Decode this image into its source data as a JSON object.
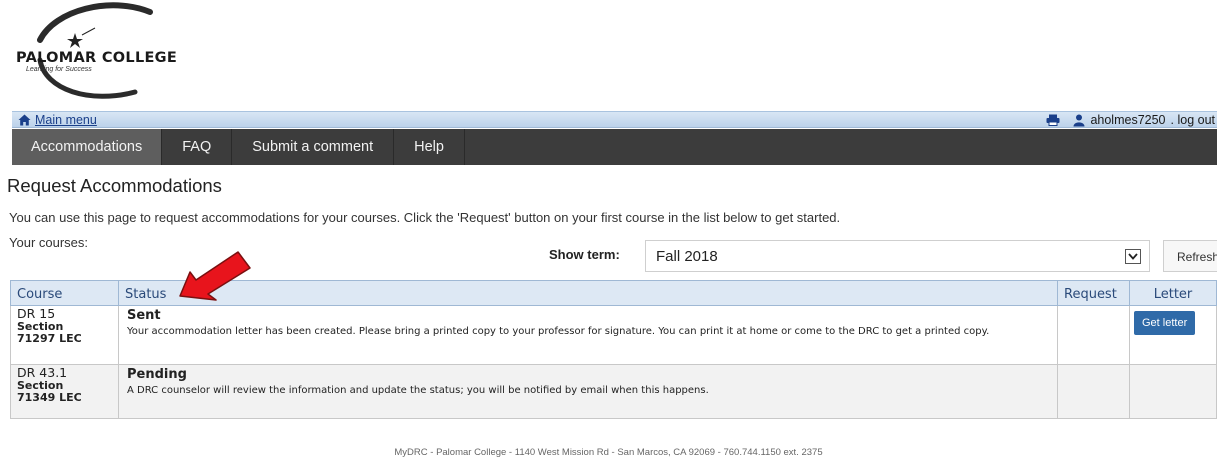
{
  "logo": {
    "name": "PALOMAR COLLEGE",
    "tagline": "Learning for Success"
  },
  "topbar": {
    "home_label": "Main menu",
    "user": "aholmes7250",
    "logout": ". log out"
  },
  "nav": {
    "tabs": [
      {
        "label": "Accommodations",
        "active": true
      },
      {
        "label": "FAQ",
        "active": false
      },
      {
        "label": "Submit a comment",
        "active": false
      },
      {
        "label": "Help",
        "active": false
      }
    ]
  },
  "page": {
    "title": "Request Accommodations",
    "intro": "You can use this page to request accommodations for your courses. Click the 'Request' button on your first course in the list below to get started.",
    "courses_label": "Your courses:",
    "term_label": "Show term:",
    "term_value": "Fall 2018",
    "refresh_label": "Refresh"
  },
  "table": {
    "headers": {
      "course": "Course",
      "status": "Status",
      "request": "Request",
      "letter": "Letter"
    },
    "rows": [
      {
        "code": "DR 15",
        "section_label": "Section",
        "section": "71297 LEC",
        "status": "Sent",
        "description": "Your accommodation letter has been created. Please bring a printed copy to your professor for signature. You can print it at home or come to the DRC to get a printed copy.",
        "letter_button": "Get letter"
      },
      {
        "code": "DR 43.1",
        "section_label": "Section",
        "section": "71349 LEC",
        "status": "Pending",
        "description": "A DRC counselor will review the information and update the status; you will be notified by email when this happens.",
        "letter_button": ""
      }
    ]
  },
  "footer": "MyDRC - Palomar College - 1140 West Mission Rd - San Marcos, CA 92069 - 760.744.1150 ext. 2375",
  "colors": {
    "nav_bg": "#3c3c3c",
    "nav_active": "#5e5e5e",
    "topbar": "#c9dbef",
    "button": "#2f6aa8",
    "annotation_arrow": "#e8141c"
  }
}
